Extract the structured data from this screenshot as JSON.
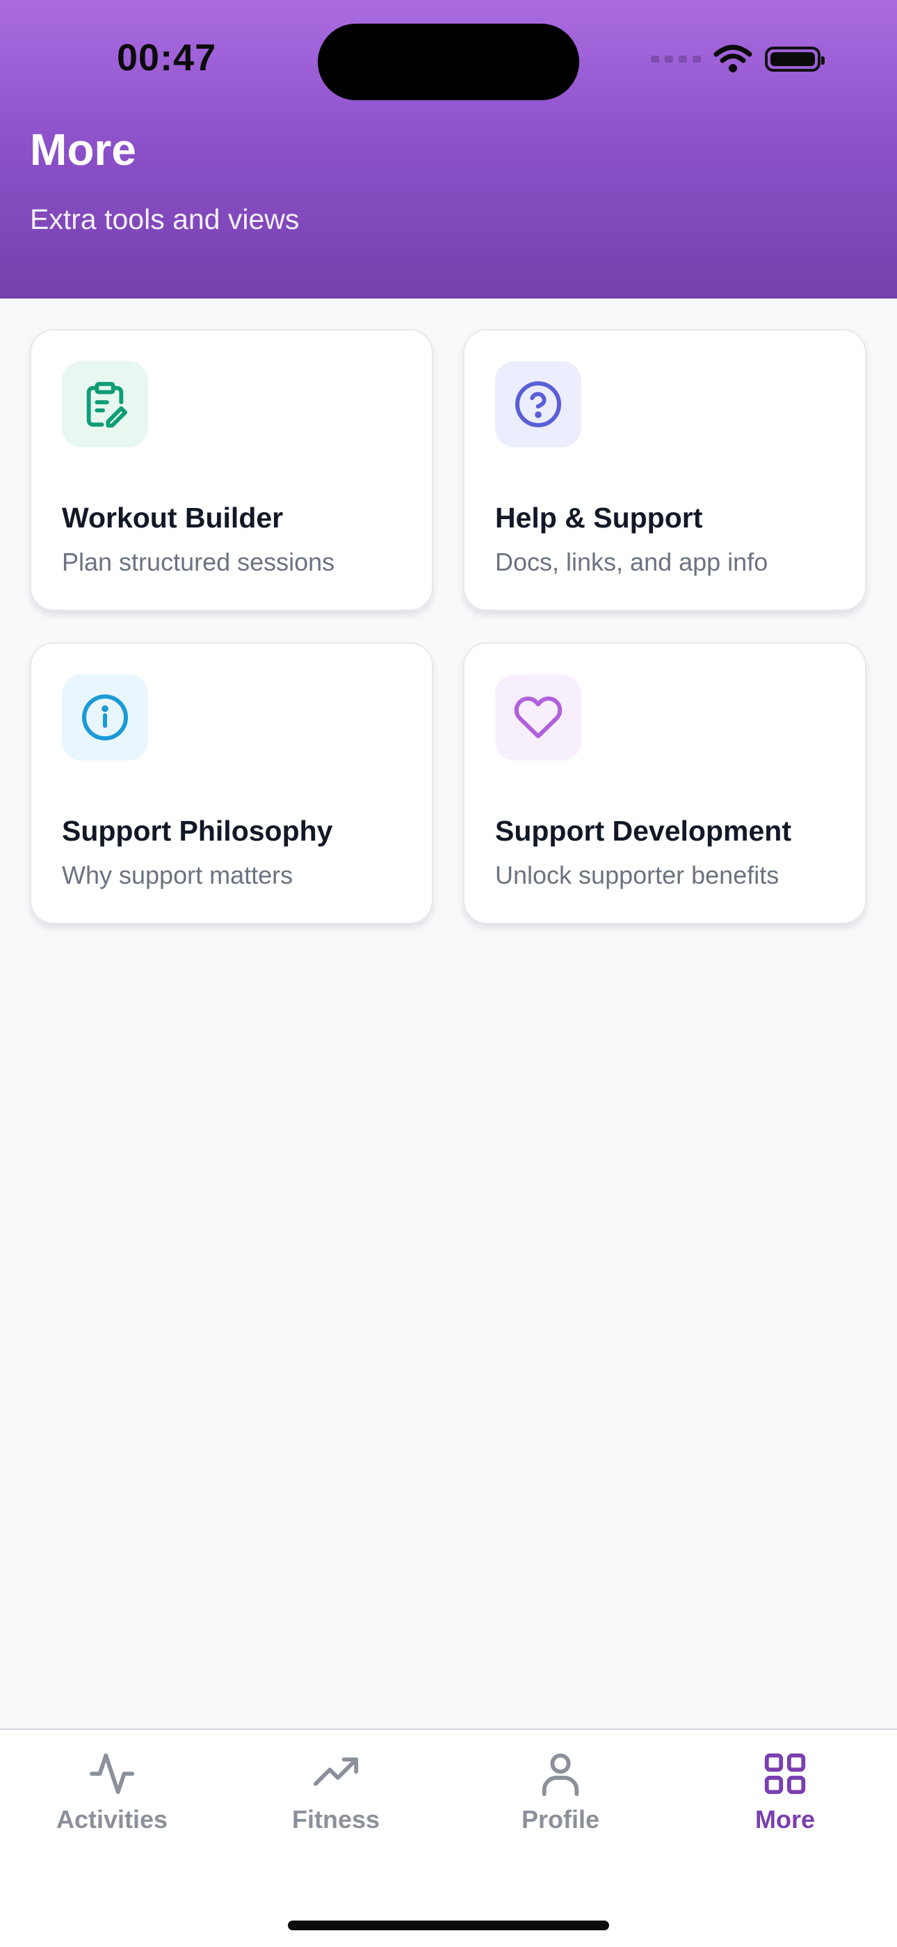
{
  "status_bar": {
    "time": "00:47"
  },
  "header": {
    "title": "More",
    "subtitle": "Extra tools and views"
  },
  "cards": [
    {
      "title": "Workout Builder",
      "subtitle": "Plan structured sessions",
      "icon": "clipboard-edit-icon",
      "accent": "#0f9d76",
      "tile": "#e8f8f1"
    },
    {
      "title": "Help & Support",
      "subtitle": "Docs, links, and app info",
      "icon": "help-circle-icon",
      "accent": "#5b5fd6",
      "tile": "#eceefd"
    },
    {
      "title": "Support Philosophy",
      "subtitle": "Why support matters",
      "icon": "info-circle-icon",
      "accent": "#1a9ad6",
      "tile": "#eaf6fd"
    },
    {
      "title": "Support Development",
      "subtitle": "Unlock supporter benefits",
      "icon": "heart-icon",
      "accent": "#b160dc",
      "tile": "#f8effd"
    }
  ],
  "tabbar": {
    "tabs": [
      {
        "label": "Activities",
        "icon": "activity-icon"
      },
      {
        "label": "Fitness",
        "icon": "trending-up-icon"
      },
      {
        "label": "Profile",
        "icon": "user-icon"
      },
      {
        "label": "More",
        "icon": "grid-icon"
      }
    ],
    "active": "More",
    "active_color": "#7a3fb0",
    "inactive_color": "#8c909a"
  }
}
